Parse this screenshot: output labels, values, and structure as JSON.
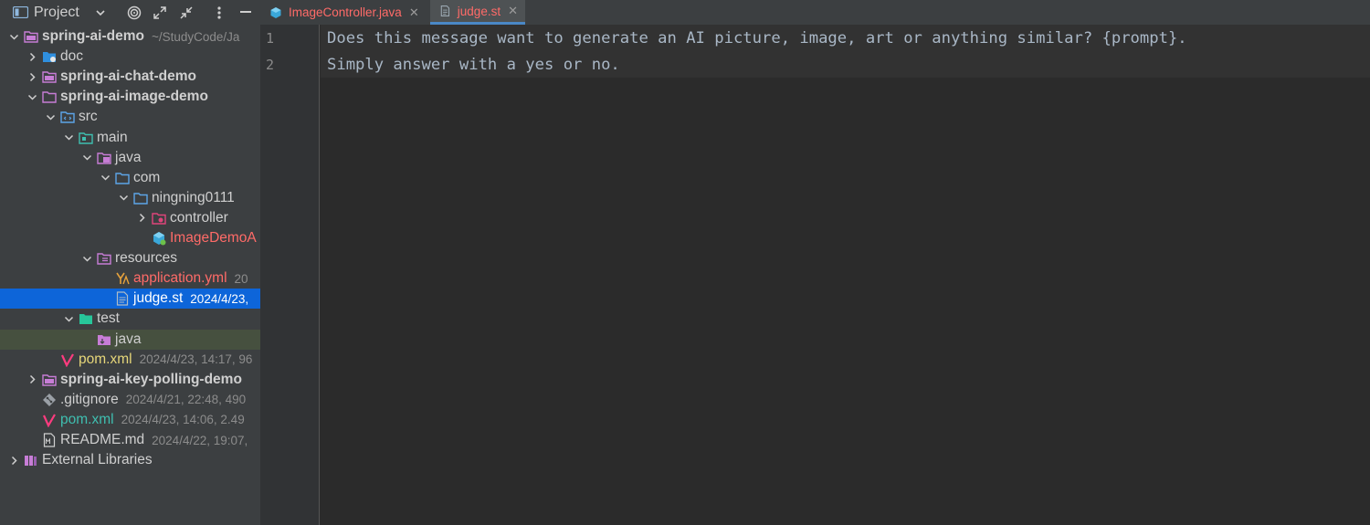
{
  "panel": {
    "title": "Project",
    "header_icons": [
      "chevron-down-icon",
      "target-icon",
      "expand-icon",
      "collapse-icon",
      "more-vertical-icon",
      "minimize-icon"
    ]
  },
  "tree": [
    {
      "label": "spring-ai-demo",
      "meta": "~/StudyCode/Ja",
      "bold": true,
      "indent": 0,
      "chevron": "down",
      "icon": "module-folder"
    },
    {
      "label": "doc",
      "meta": "",
      "indent": 1,
      "chevron": "right",
      "icon": "folder-blue-dot"
    },
    {
      "label": "spring-ai-chat-demo",
      "meta": "",
      "bold": true,
      "indent": 1,
      "chevron": "right",
      "icon": "module-folder"
    },
    {
      "label": "spring-ai-image-demo",
      "meta": "",
      "bold": true,
      "indent": 1,
      "chevron": "down",
      "icon": "module-folder-open"
    },
    {
      "label": "src",
      "meta": "",
      "indent": 2,
      "chevron": "down",
      "icon": "source-folder"
    },
    {
      "label": "main",
      "meta": "",
      "indent": 3,
      "chevron": "down",
      "icon": "main-folder"
    },
    {
      "label": "java",
      "meta": "",
      "indent": 4,
      "chevron": "down",
      "icon": "java-source-folder"
    },
    {
      "label": "com",
      "meta": "",
      "indent": 5,
      "chevron": "down",
      "icon": "package-folder"
    },
    {
      "label": "ningning0111",
      "meta": "",
      "indent": 6,
      "chevron": "down",
      "icon": "package-folder"
    },
    {
      "label": "controller",
      "meta": "",
      "indent": 7,
      "chevron": "right",
      "icon": "controller-folder"
    },
    {
      "label": "ImageDemoA",
      "meta": "",
      "color": "red",
      "indent": 7,
      "chevron": "none",
      "icon": "spring-class"
    },
    {
      "label": "resources",
      "meta": "",
      "indent": 4,
      "chevron": "down",
      "icon": "resources-folder"
    },
    {
      "label": "application.yml",
      "meta": "20",
      "color": "red",
      "indent": 5,
      "chevron": "none",
      "icon": "yaml-file"
    },
    {
      "label": "judge.st",
      "meta": "2024/4/23,",
      "indent": 5,
      "chevron": "none",
      "icon": "text-file",
      "selected": true
    },
    {
      "label": "test",
      "meta": "",
      "indent": 3,
      "chevron": "down",
      "icon": "test-folder"
    },
    {
      "label": "java",
      "meta": "",
      "indent": 4,
      "chevron": "none",
      "icon": "java-test-folder",
      "hover": true
    },
    {
      "label": "pom.xml",
      "meta": "2024/4/23, 14:17, 96",
      "color": "yellow",
      "indent": 2,
      "chevron": "none",
      "icon": "maven-file"
    },
    {
      "label": "spring-ai-key-polling-demo",
      "meta": "",
      "bold": true,
      "indent": 1,
      "chevron": "right",
      "icon": "module-folder"
    },
    {
      "label": ".gitignore",
      "meta": "2024/4/21, 22:48, 490",
      "indent": 1,
      "chevron": "none",
      "icon": "gitignore-file"
    },
    {
      "label": "pom.xml",
      "meta": "2024/4/23, 14:06, 2.49",
      "color": "teal",
      "indent": 1,
      "chevron": "none",
      "icon": "maven-file"
    },
    {
      "label": "README.md",
      "meta": "2024/4/22, 19:07,",
      "indent": 1,
      "chevron": "none",
      "icon": "markdown-file"
    },
    {
      "label": "External Libraries",
      "meta": "",
      "indent": 0,
      "chevron": "right",
      "icon": "libraries"
    }
  ],
  "tabs": [
    {
      "label": "ImageController.java",
      "icon": "java-class-icon",
      "active": false
    },
    {
      "label": "judge.st",
      "icon": "text-file-icon",
      "active": true
    }
  ],
  "editor": {
    "lines": [
      {
        "number": "1",
        "text": "Does this message want to generate an AI picture, image, art or anything similar? {prompt}."
      },
      {
        "number": "2",
        "text": "Simply answer with a yes or no."
      }
    ]
  },
  "colors": {
    "selection": "#0d65d9",
    "accent_tab_underline": "#4a88c7",
    "modified_file": "#ff6b68",
    "panel_bg": "#3c3f41",
    "editor_bg": "#2b2b2b"
  }
}
